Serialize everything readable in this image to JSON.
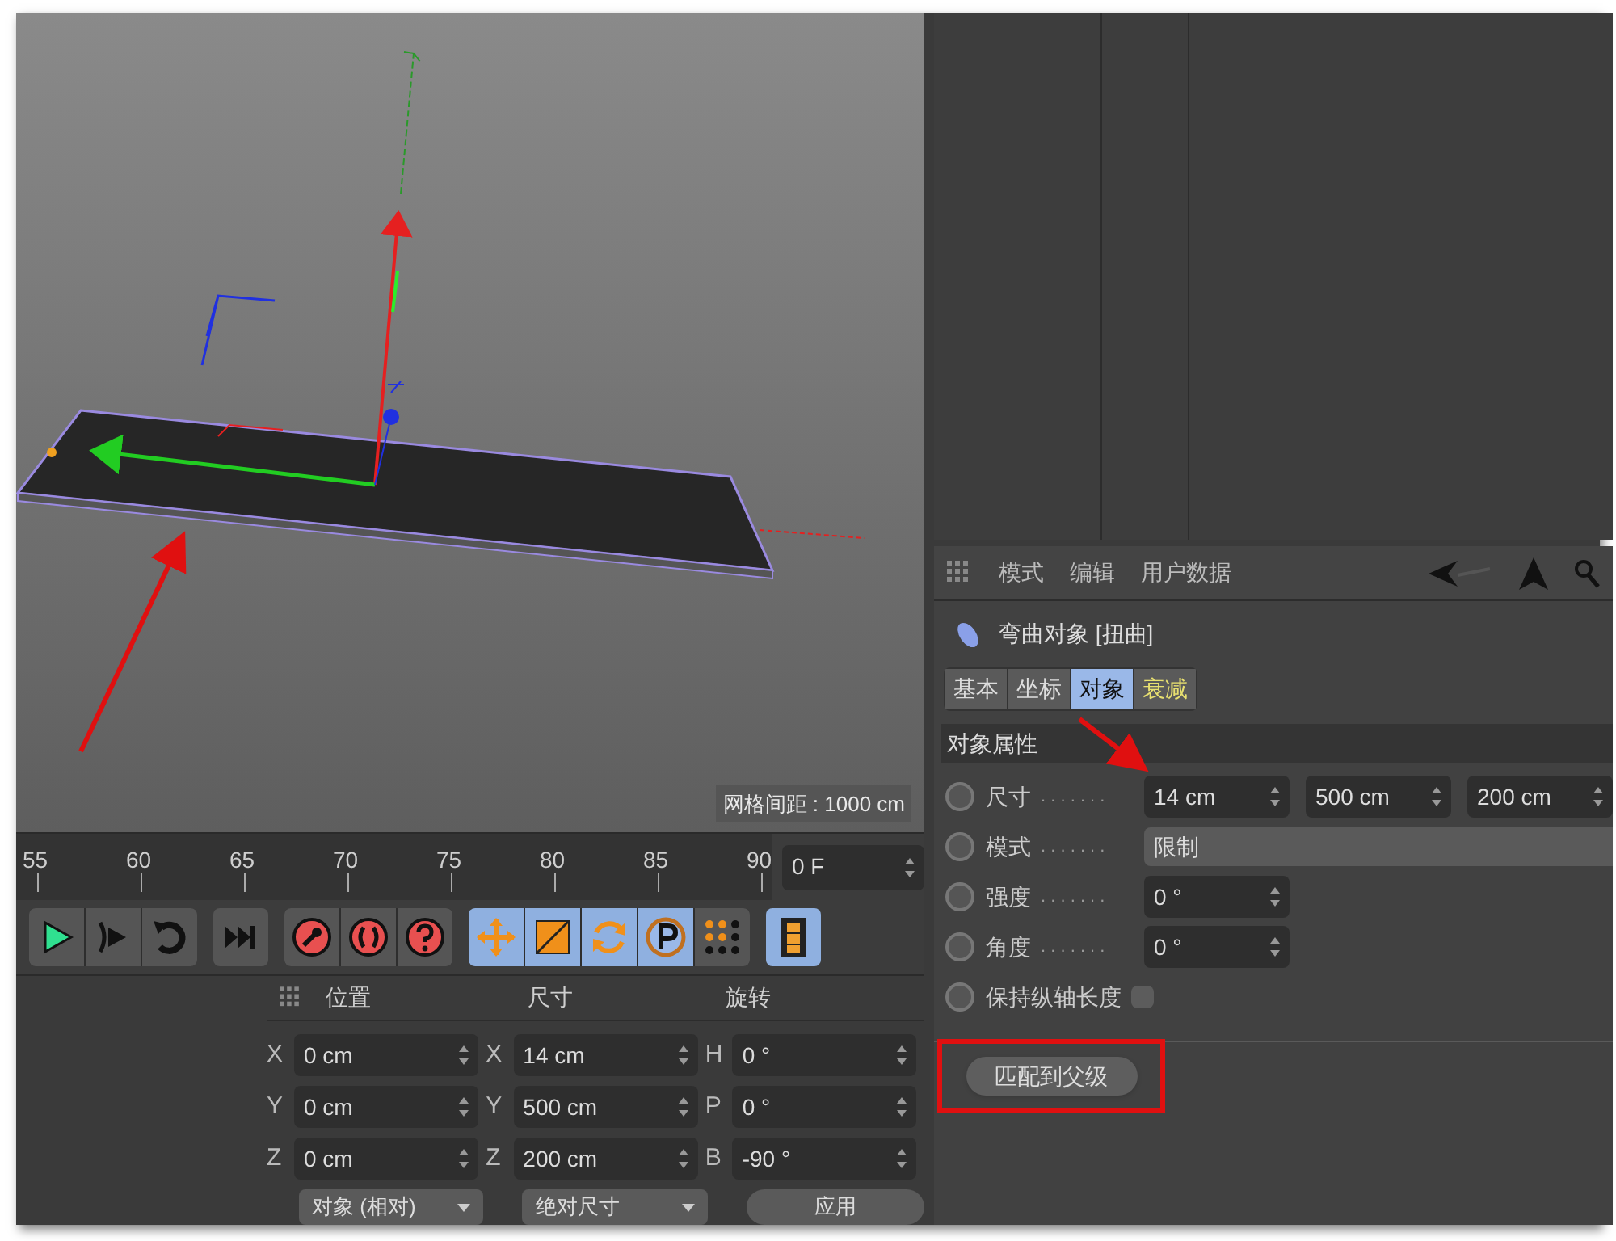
{
  "viewport": {
    "grid_label": "网格间距 : 1000 cm"
  },
  "timeline": {
    "ticks": [
      "55",
      "60",
      "65",
      "70",
      "75",
      "80",
      "85",
      "90"
    ],
    "frame": "0 F"
  },
  "toolbar": [
    {
      "buttons": [
        {
          "kind": "play",
          "selected": false
        },
        {
          "kind": "step",
          "selected": false
        },
        {
          "kind": "loop",
          "selected": false
        }
      ]
    },
    {
      "buttons": [
        {
          "kind": "end",
          "selected": false
        }
      ]
    },
    {
      "buttons": [
        {
          "kind": "key",
          "selected": false
        },
        {
          "kind": "autokey",
          "selected": false
        },
        {
          "kind": "help",
          "selected": false
        }
      ]
    },
    {
      "buttons": [
        {
          "kind": "move",
          "selected": true
        },
        {
          "kind": "scale",
          "selected": true
        },
        {
          "kind": "rotate",
          "selected": true
        },
        {
          "kind": "param",
          "selected": true
        },
        {
          "kind": "points",
          "selected": false
        }
      ]
    },
    {
      "buttons": [
        {
          "kind": "film",
          "selected": true
        }
      ]
    }
  ],
  "coordinates": {
    "columns": [
      {
        "heading": "位置",
        "rows": [
          {
            "axis": "X",
            "value": "0 cm"
          },
          {
            "axis": "Y",
            "value": "0 cm"
          },
          {
            "axis": "Z",
            "value": "0 cm"
          }
        ]
      },
      {
        "heading": "尺寸",
        "rows": [
          {
            "axis": "X",
            "value": "14 cm"
          },
          {
            "axis": "Y",
            "value": "500 cm"
          },
          {
            "axis": "Z",
            "value": "200 cm"
          }
        ]
      },
      {
        "heading": "旋转",
        "rows": [
          {
            "axis": "H",
            "value": "0 °"
          },
          {
            "axis": "P",
            "value": "0 °"
          },
          {
            "axis": "B",
            "value": "-90 °"
          }
        ]
      }
    ],
    "controls": [
      {
        "kind": "dropdown",
        "label": "对象 (相对)"
      },
      {
        "kind": "dropdown",
        "label": "绝对尺寸"
      },
      {
        "kind": "button",
        "label": "应用"
      }
    ]
  },
  "attributes": {
    "menu": [
      "模式",
      "编辑",
      "用户数据"
    ],
    "object_title": "弯曲对象 [扭曲]",
    "tabs": [
      {
        "label": "基本",
        "selected": false,
        "highlighted": false
      },
      {
        "label": "坐标",
        "selected": false,
        "highlighted": false
      },
      {
        "label": "对象",
        "selected": true,
        "highlighted": false
      },
      {
        "label": "衰减",
        "selected": false,
        "highlighted": true
      }
    ],
    "section": "对象属性",
    "params": [
      {
        "kind": "vector",
        "label": "尺寸",
        "leader": ". . . . . . .",
        "values": [
          "14 cm",
          "500 cm",
          "200 cm"
        ]
      },
      {
        "kind": "dropdown",
        "label": "模式",
        "leader": ". . . . . . .",
        "value": "限制"
      },
      {
        "kind": "number",
        "label": "强度",
        "leader": ". . . . . . .",
        "value": "0 °"
      },
      {
        "kind": "number",
        "label": "角度",
        "leader": ". . . . . . .",
        "value": "0 °"
      },
      {
        "kind": "checkbox",
        "label": "保持纵轴长度",
        "checked": false
      }
    ],
    "button": "匹配到父级"
  }
}
